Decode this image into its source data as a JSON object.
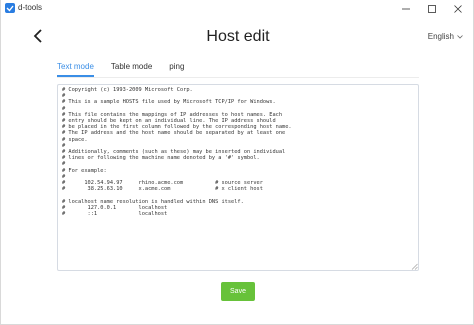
{
  "window": {
    "app_title": "d-tools",
    "app_icon": "d-tools-logo-icon",
    "controls": [
      "minimize-icon",
      "maximize-icon",
      "close-icon"
    ]
  },
  "header": {
    "back_icon": "chevron-left-icon",
    "title": "Host edit",
    "language": "English",
    "language_icon": "chevron-down-icon"
  },
  "tabs": [
    {
      "label": "Text mode",
      "active": true
    },
    {
      "label": "Table mode",
      "active": false
    },
    {
      "label": "ping",
      "active": false
    }
  ],
  "editor": {
    "content": "# Copyright (c) 1993-2009 Microsoft Corp.\n#\n# This is a sample HOSTS file used by Microsoft TCP/IP for Windows.\n#\n# This file contains the mappings of IP addresses to host names. Each\n# entry should be kept on an individual line. The IP address should\n# be placed in the first column followed by the corresponding host name.\n# The IP address and the host name should be separated by at least one\n# space.\n#\n# Additionally, comments (such as these) may be inserted on individual\n# lines or following the machine name denoted by a '#' symbol.\n#\n# For example:\n#\n#      102.54.94.97     rhino.acme.com          # source server\n#       38.25.63.10     x.acme.com              # x client host\n\n# localhost name resolution is handled within DNS itself.\n#\t127.0.0.1       localhost\n#\t::1             localhost"
  },
  "actions": {
    "save_label": "Save"
  },
  "colors": {
    "accent": "#3a8ee6",
    "save": "#67c23a",
    "app_icon": "#2a7de1"
  }
}
